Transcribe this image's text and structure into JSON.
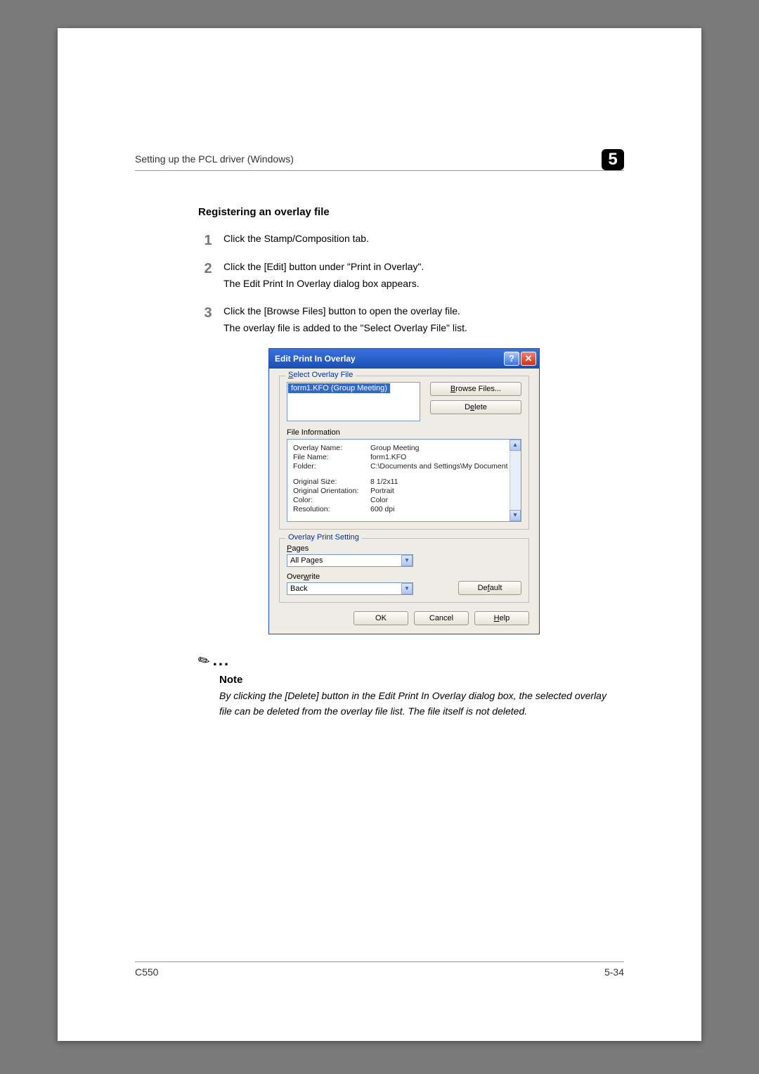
{
  "header": {
    "text": "Setting up the PCL driver (Windows)",
    "chapter_number": "5"
  },
  "section_title": "Registering an overlay file",
  "steps": [
    {
      "text": "Click the Stamp/Composition tab."
    },
    {
      "text": "Click the [Edit] button under \"Print in Overlay\".",
      "sub": "The Edit Print In Overlay dialog box appears."
    },
    {
      "text": "Click the [Browse Files] button to open the overlay file.",
      "sub": "The overlay file is added to the \"Select Overlay File\" list."
    }
  ],
  "dialog": {
    "title": "Edit Print In Overlay",
    "select_group_label": "Select Overlay File",
    "selected_item": "form1.KFO (Group Meeting)",
    "browse_btn_pre": "B",
    "browse_btn_rest": "rowse Files...",
    "delete_btn_pre": "D",
    "delete_btn_rest": "elete",
    "file_info_label": "File Information",
    "info": {
      "overlay_name_k": "Overlay Name:",
      "overlay_name_v": "Group Meeting",
      "file_name_k": "File Name:",
      "file_name_v": "form1.KFO",
      "folder_k": "Folder:",
      "folder_v": "C:\\Documents and Settings\\My Document",
      "size_k": "Original Size:",
      "size_v": "8 1/2x11",
      "orient_k": "Original Orientation:",
      "orient_v": "Portrait",
      "color_k": "Color:",
      "color_v": "Color",
      "res_k": "Resolution:",
      "res_v": "600 dpi"
    },
    "ops_label": "Overlay Print Setting",
    "pages_label": "Pages",
    "pages_value": "All Pages",
    "overwrite_label_pre": "Over",
    "overwrite_label_accel": "w",
    "overwrite_label_rest": "rite",
    "overwrite_value": "Back",
    "default_btn_pre": "De",
    "default_btn_accel": "f",
    "default_btn_rest": "ault",
    "ok_btn": "OK",
    "cancel_btn": "Cancel",
    "help_btn_accel": "H",
    "help_btn_rest": "elp"
  },
  "note": {
    "label": "Note",
    "text": "By clicking the [Delete] button in the Edit Print In Overlay dialog box, the selected overlay file can be deleted from the overlay file list. The file itself is not deleted."
  },
  "footer": {
    "left": "C550",
    "right": "5-34"
  }
}
